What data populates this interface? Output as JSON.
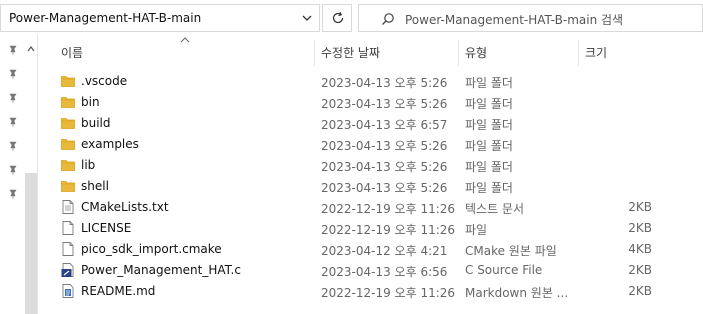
{
  "address": {
    "path": "Power-Management-HAT-B-main"
  },
  "search": {
    "placeholder": "Power-Management-HAT-B-main 검색"
  },
  "columns": {
    "name": "이름",
    "date": "수정한 날짜",
    "type": "유형",
    "size": "크기"
  },
  "files": [
    {
      "name": ".vscode",
      "date": "2023-04-13 오후 5:26",
      "type": "파일 폴더",
      "size": "",
      "icon": "folder-icon"
    },
    {
      "name": "bin",
      "date": "2023-04-13 오후 5:26",
      "type": "파일 폴더",
      "size": "",
      "icon": "folder-icon"
    },
    {
      "name": "build",
      "date": "2023-04-13 오후 6:57",
      "type": "파일 폴더",
      "size": "",
      "icon": "folder-icon"
    },
    {
      "name": "examples",
      "date": "2023-04-13 오후 5:26",
      "type": "파일 폴더",
      "size": "",
      "icon": "folder-icon"
    },
    {
      "name": "lib",
      "date": "2023-04-13 오후 5:26",
      "type": "파일 폴더",
      "size": "",
      "icon": "folder-icon"
    },
    {
      "name": "shell",
      "date": "2023-04-13 오후 5:26",
      "type": "파일 폴더",
      "size": "",
      "icon": "folder-icon"
    },
    {
      "name": "CMakeLists.txt",
      "date": "2022-12-19 오후 11:26",
      "type": "텍스트 문서",
      "size": "2KB",
      "icon": "text-file-icon"
    },
    {
      "name": "LICENSE",
      "date": "2022-12-19 오후 11:26",
      "type": "파일",
      "size": "2KB",
      "icon": "blank-file-icon"
    },
    {
      "name": "pico_sdk_import.cmake",
      "date": "2023-04-12 오후 4:21",
      "type": "CMake 원본 파일",
      "size": "4KB",
      "icon": "cmake-file-icon"
    },
    {
      "name": "Power_Management_HAT.c",
      "date": "2023-04-13 오후 6:56",
      "type": "C Source File",
      "size": "2KB",
      "icon": "c-source-file-icon"
    },
    {
      "name": "README.md",
      "date": "2022-12-19 오후 11:26",
      "type": "Markdown 원본 ...",
      "size": "2KB",
      "icon": "markdown-file-icon"
    }
  ],
  "colors": {
    "folder": "#e8b93a",
    "folder_dark": "#d9a21b",
    "c_file": "#2b3f8a"
  }
}
